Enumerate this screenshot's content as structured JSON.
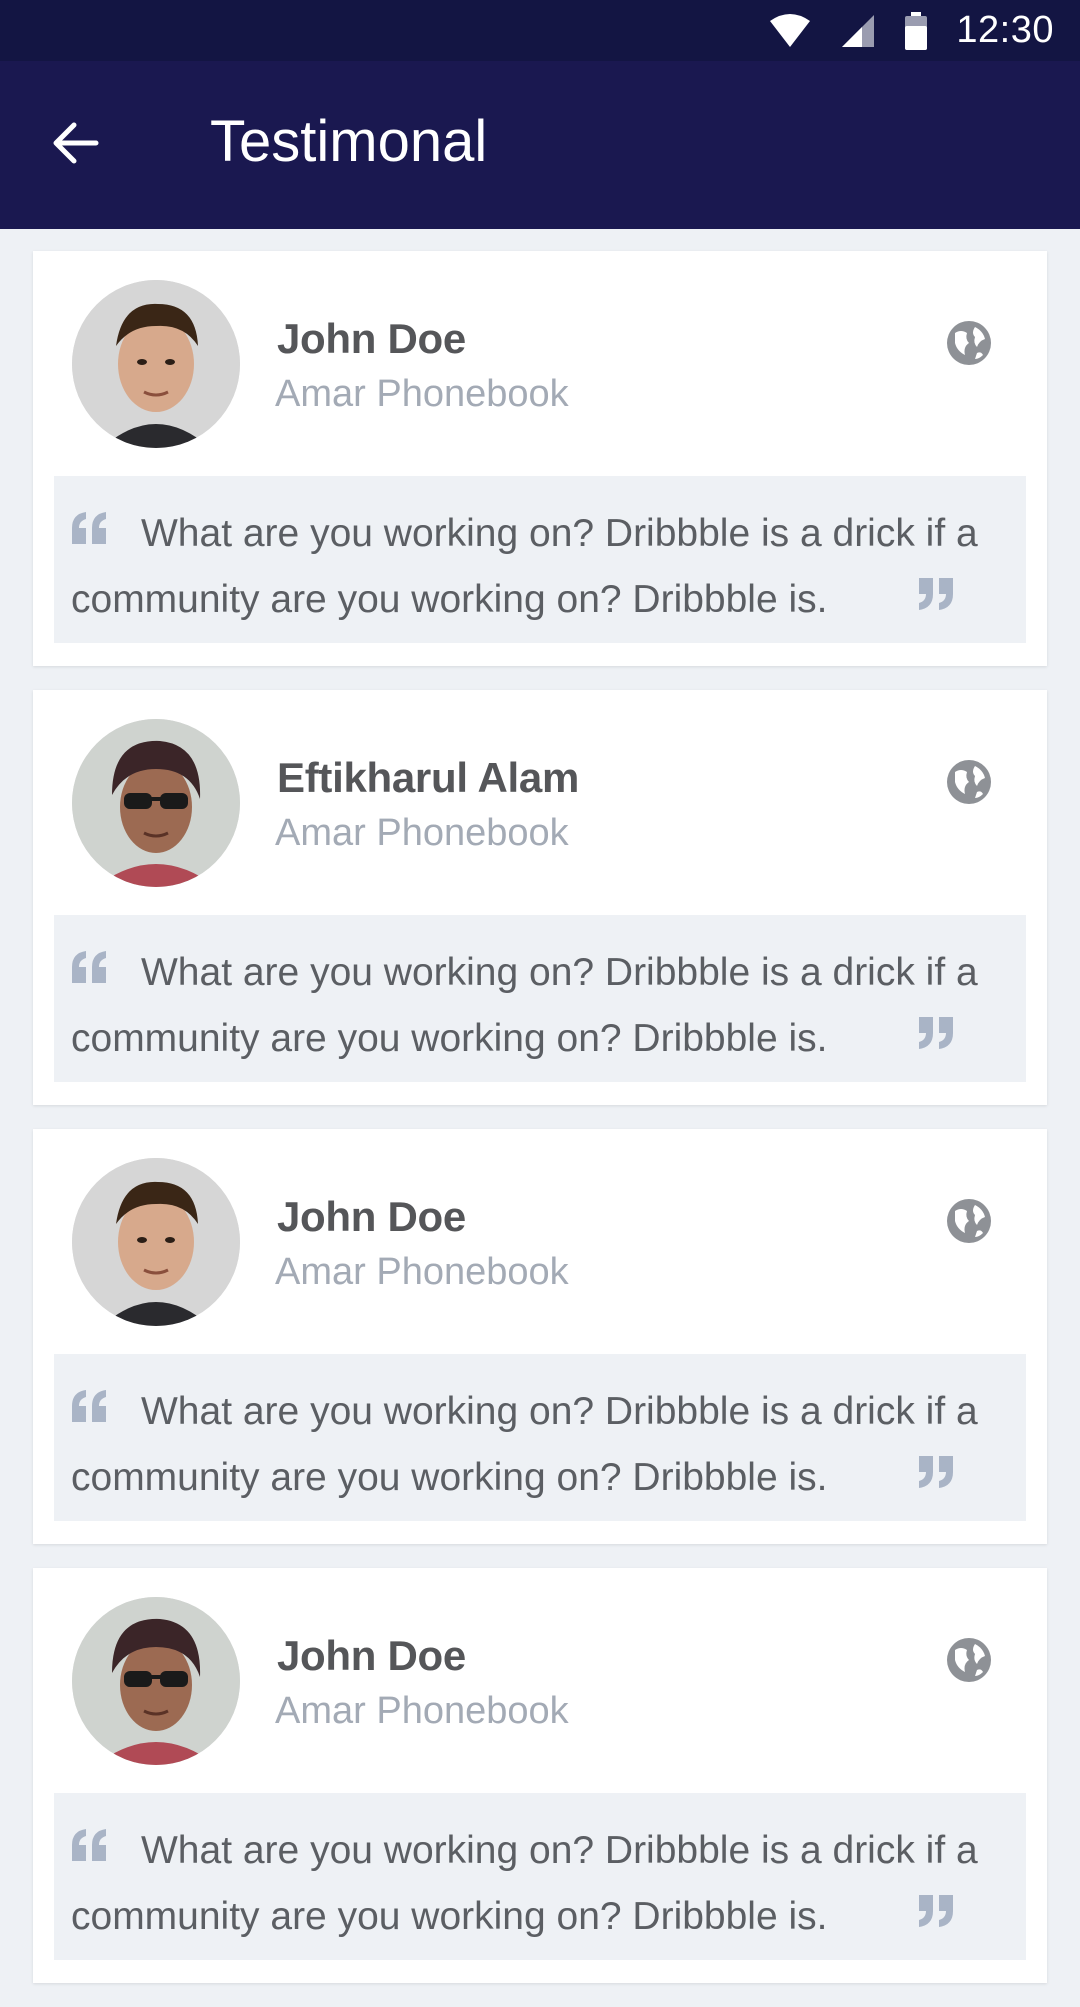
{
  "status_bar": {
    "time": "12:30",
    "wifi_icon": "wifi-icon",
    "signal_icon": "signal-icon",
    "battery_icon": "battery-icon"
  },
  "app_bar": {
    "title": "Testimonal",
    "back_icon": "arrow-back-icon",
    "background": "#1a1850"
  },
  "testimonials": [
    {
      "name": "John Doe",
      "company": "Amar Phonebook",
      "quote": "What are you working on? Dribbble is a drick if a community are you working on? Dribbble is.",
      "avatar": "man-portrait",
      "link_icon": "globe-icon"
    },
    {
      "name": "Eftikharul Alam",
      "company": "Amar Phonebook",
      "quote": "What are you working on? Dribbble is a drick if a community are you working on? Dribbble is.",
      "avatar": "man-sunglasses-portrait",
      "link_icon": "globe-icon"
    },
    {
      "name": "John Doe",
      "company": "Amar Phonebook",
      "quote": "What are you working on? Dribbble is a drick if a community are you working on? Dribbble is.",
      "avatar": "man-portrait",
      "link_icon": "globe-icon"
    },
    {
      "name": "John Doe",
      "company": "Amar Phonebook",
      "quote": "What are you working on? Dribbble is a drick if a community are you working on? Dribbble is.",
      "avatar": "man-sunglasses-portrait",
      "link_icon": "globe-icon"
    }
  ],
  "colors": {
    "accent": "#1a1850",
    "status_bar": "#131543",
    "name": "#555659",
    "company": "#a3aab5",
    "quote_bg": "#eef1f5",
    "quote_mark": "#a9b4c6"
  }
}
